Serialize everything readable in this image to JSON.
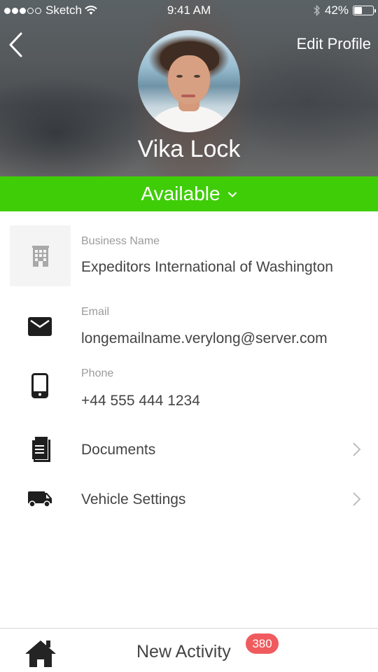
{
  "status_bar": {
    "carrier": "Sketch",
    "signal_bars_filled": 3,
    "signal_bars_total": 5,
    "time": "9:41 AM",
    "battery_percent_label": "42%",
    "battery_level": 0.42
  },
  "header": {
    "back_icon": "chevron-left-icon",
    "edit_profile_label": "Edit Profile",
    "user_name": "Vika Lock"
  },
  "availability": {
    "label": "Available",
    "color": "#3fcd08"
  },
  "profile_fields": [
    {
      "icon": "building-icon",
      "label": "Business Name",
      "value": "Expeditors International of Washington"
    },
    {
      "icon": "envelope-icon",
      "label": "Email",
      "value": "longemailname.verylong@server.com"
    },
    {
      "icon": "smartphone-icon",
      "label": "Phone",
      "value": "+44 555 444 1234"
    }
  ],
  "nav_items": [
    {
      "icon": "documents-icon",
      "label": "Documents"
    },
    {
      "icon": "truck-icon",
      "label": "Vehicle Settings"
    }
  ],
  "bottom_bar": {
    "home_icon": "home-icon",
    "new_activity_label": "New Activity",
    "badge_count": "380",
    "badge_color": "#ef5b5e"
  }
}
